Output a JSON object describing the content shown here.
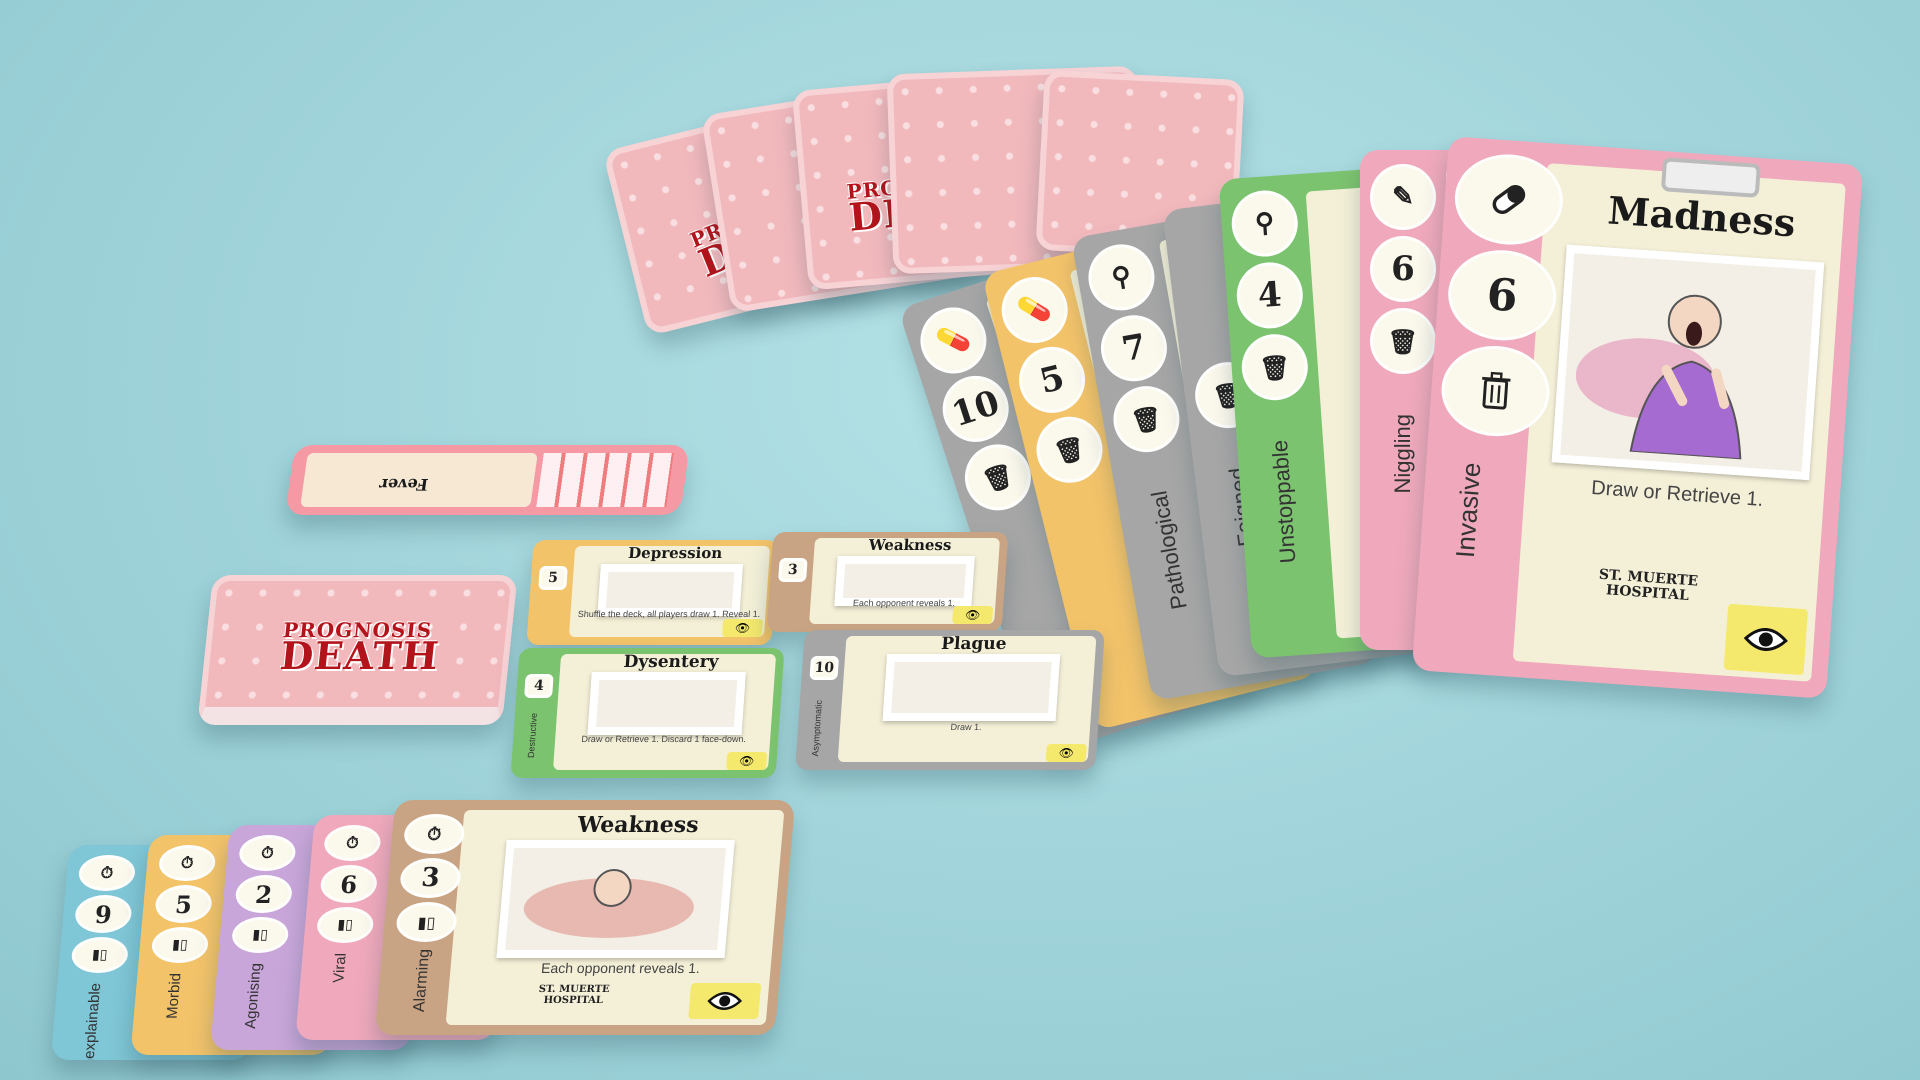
{
  "colors": {
    "pink": "#f0a9bc",
    "grey": "#a6a6a6",
    "orange": "#f3c36a",
    "green": "#7cc36f",
    "purple": "#c9a6da",
    "blue": "#7fc6d6",
    "brown": "#c9a484",
    "backRed": "#f2b9bd"
  },
  "logo": {
    "line1": "PROGNOSIS",
    "line2": "DEATH"
  },
  "hospital": {
    "line1": "ST. MUERTE",
    "line2": "HOSPITAL"
  },
  "flying_hand": [
    {
      "color": "grey",
      "value": "10",
      "tag": "",
      "icon": "pill-icon"
    },
    {
      "color": "orange",
      "value": "5",
      "tag": "",
      "icon": "pill-icon"
    },
    {
      "color": "grey",
      "value": "7",
      "tag": "Pathological",
      "icon": "iv-bag-icon"
    },
    {
      "color": "grey",
      "value": "",
      "tag": "Feigned",
      "icon": ""
    },
    {
      "color": "green",
      "value": "4",
      "tag": "Unstoppable",
      "icon": "iv-bag-icon"
    },
    {
      "color": "pink",
      "value": "6",
      "tag": "Niggling",
      "icon": "syringe-icon"
    },
    {
      "color": "pink",
      "value": "6",
      "tag": "Invasive",
      "icon": "pill-icon"
    }
  ],
  "madness_card": {
    "title": "Madness",
    "value": "6",
    "tag": "Invasive",
    "text": "Draw or Retrieve 1."
  },
  "table_cards": [
    {
      "title": "Depression",
      "value": "5",
      "color": "orange",
      "text": "Shuffle the deck, all players draw 1. Reveal 1."
    },
    {
      "title": "Weakness",
      "value": "3",
      "color": "brown",
      "text": "Each opponent reveals 1."
    },
    {
      "title": "Dysentery",
      "value": "4",
      "color": "green",
      "tag": "Destructive",
      "text": "Draw or Retrieve 1. Discard 1 face-down."
    },
    {
      "title": "Plague",
      "value": "10",
      "color": "grey",
      "tag": "Asymptomatic",
      "text": "Draw 1."
    }
  ],
  "flipped_card": {
    "title": "Fever"
  },
  "bottom_row": [
    {
      "color": "blue",
      "value": "9",
      "tag": "Unexplainable"
    },
    {
      "color": "orange",
      "value": "5",
      "tag": "Morbid"
    },
    {
      "color": "purple",
      "value": "2",
      "tag": "Agonising"
    },
    {
      "color": "pink",
      "value": "6",
      "tag": "Viral"
    }
  ],
  "weakness_card": {
    "title": "Weakness",
    "value": "3",
    "tag": "Alarming",
    "text": "Each opponent reveals 1."
  }
}
